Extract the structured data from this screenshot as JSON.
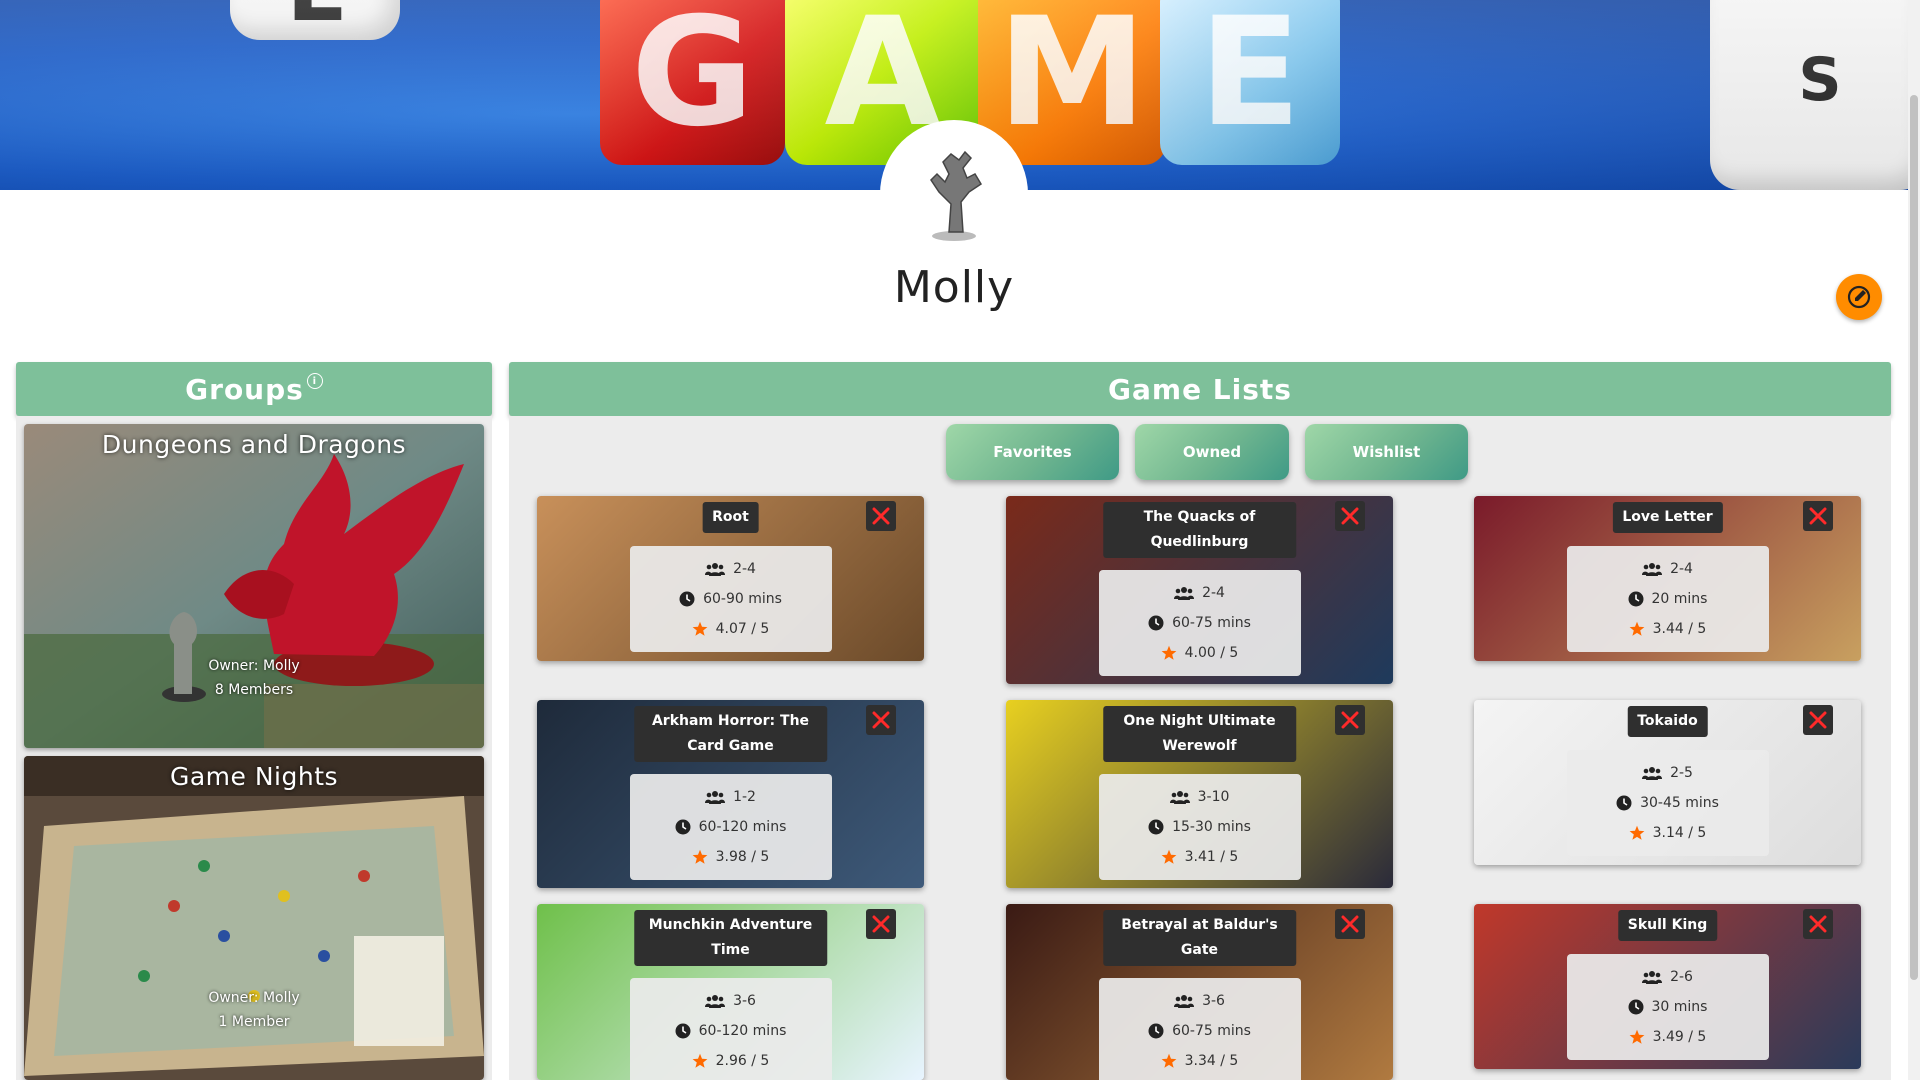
{
  "banner": {
    "letters": [
      "G",
      "A",
      "M",
      "E"
    ]
  },
  "profile": {
    "name": "Molly"
  },
  "groups": {
    "title": "Groups",
    "items": [
      {
        "name": "Dungeons and Dragons",
        "owner": "Owner: Molly",
        "members": "8 Members"
      },
      {
        "name": "Game Nights",
        "owner": "Owner: Molly",
        "members": "1 Member"
      }
    ]
  },
  "game_lists": {
    "title": "Game Lists",
    "tabs": [
      "Favorites",
      "Owned",
      "Wishlist"
    ],
    "games": [
      {
        "name": "Root",
        "players": "2-4",
        "time": "60-90 mins",
        "rating": "4.07 / 5"
      },
      {
        "name": "The Quacks of Quedlinburg",
        "players": "2-4",
        "time": "60-75 mins",
        "rating": "4.00 / 5"
      },
      {
        "name": "Love Letter",
        "players": "2-4",
        "time": "20 mins",
        "rating": "3.44 / 5"
      },
      {
        "name": "Arkham Horror: The Card Game",
        "players": "1-2",
        "time": "60-120 mins",
        "rating": "3.98 / 5"
      },
      {
        "name": "One Night Ultimate Werewolf",
        "players": "3-10",
        "time": "15-30 mins",
        "rating": "3.41 / 5"
      },
      {
        "name": "Tokaido",
        "players": "2-5",
        "time": "30-45 mins",
        "rating": "3.14 / 5"
      },
      {
        "name": "Munchkin Adventure Time",
        "players": "3-6",
        "time": "60-120 mins",
        "rating": "2.96 / 5"
      },
      {
        "name": "Betrayal at Baldur's Gate",
        "players": "3-6",
        "time": "60-75 mins",
        "rating": "3.34 / 5"
      },
      {
        "name": "Skull King",
        "players": "2-6",
        "time": "30 mins",
        "rating": "3.49 / 5"
      }
    ]
  },
  "colors": {
    "accent": "#7ec09a",
    "edit": "#ff8c00",
    "star": "#ff6a00",
    "remove": "#ff2a2a"
  }
}
